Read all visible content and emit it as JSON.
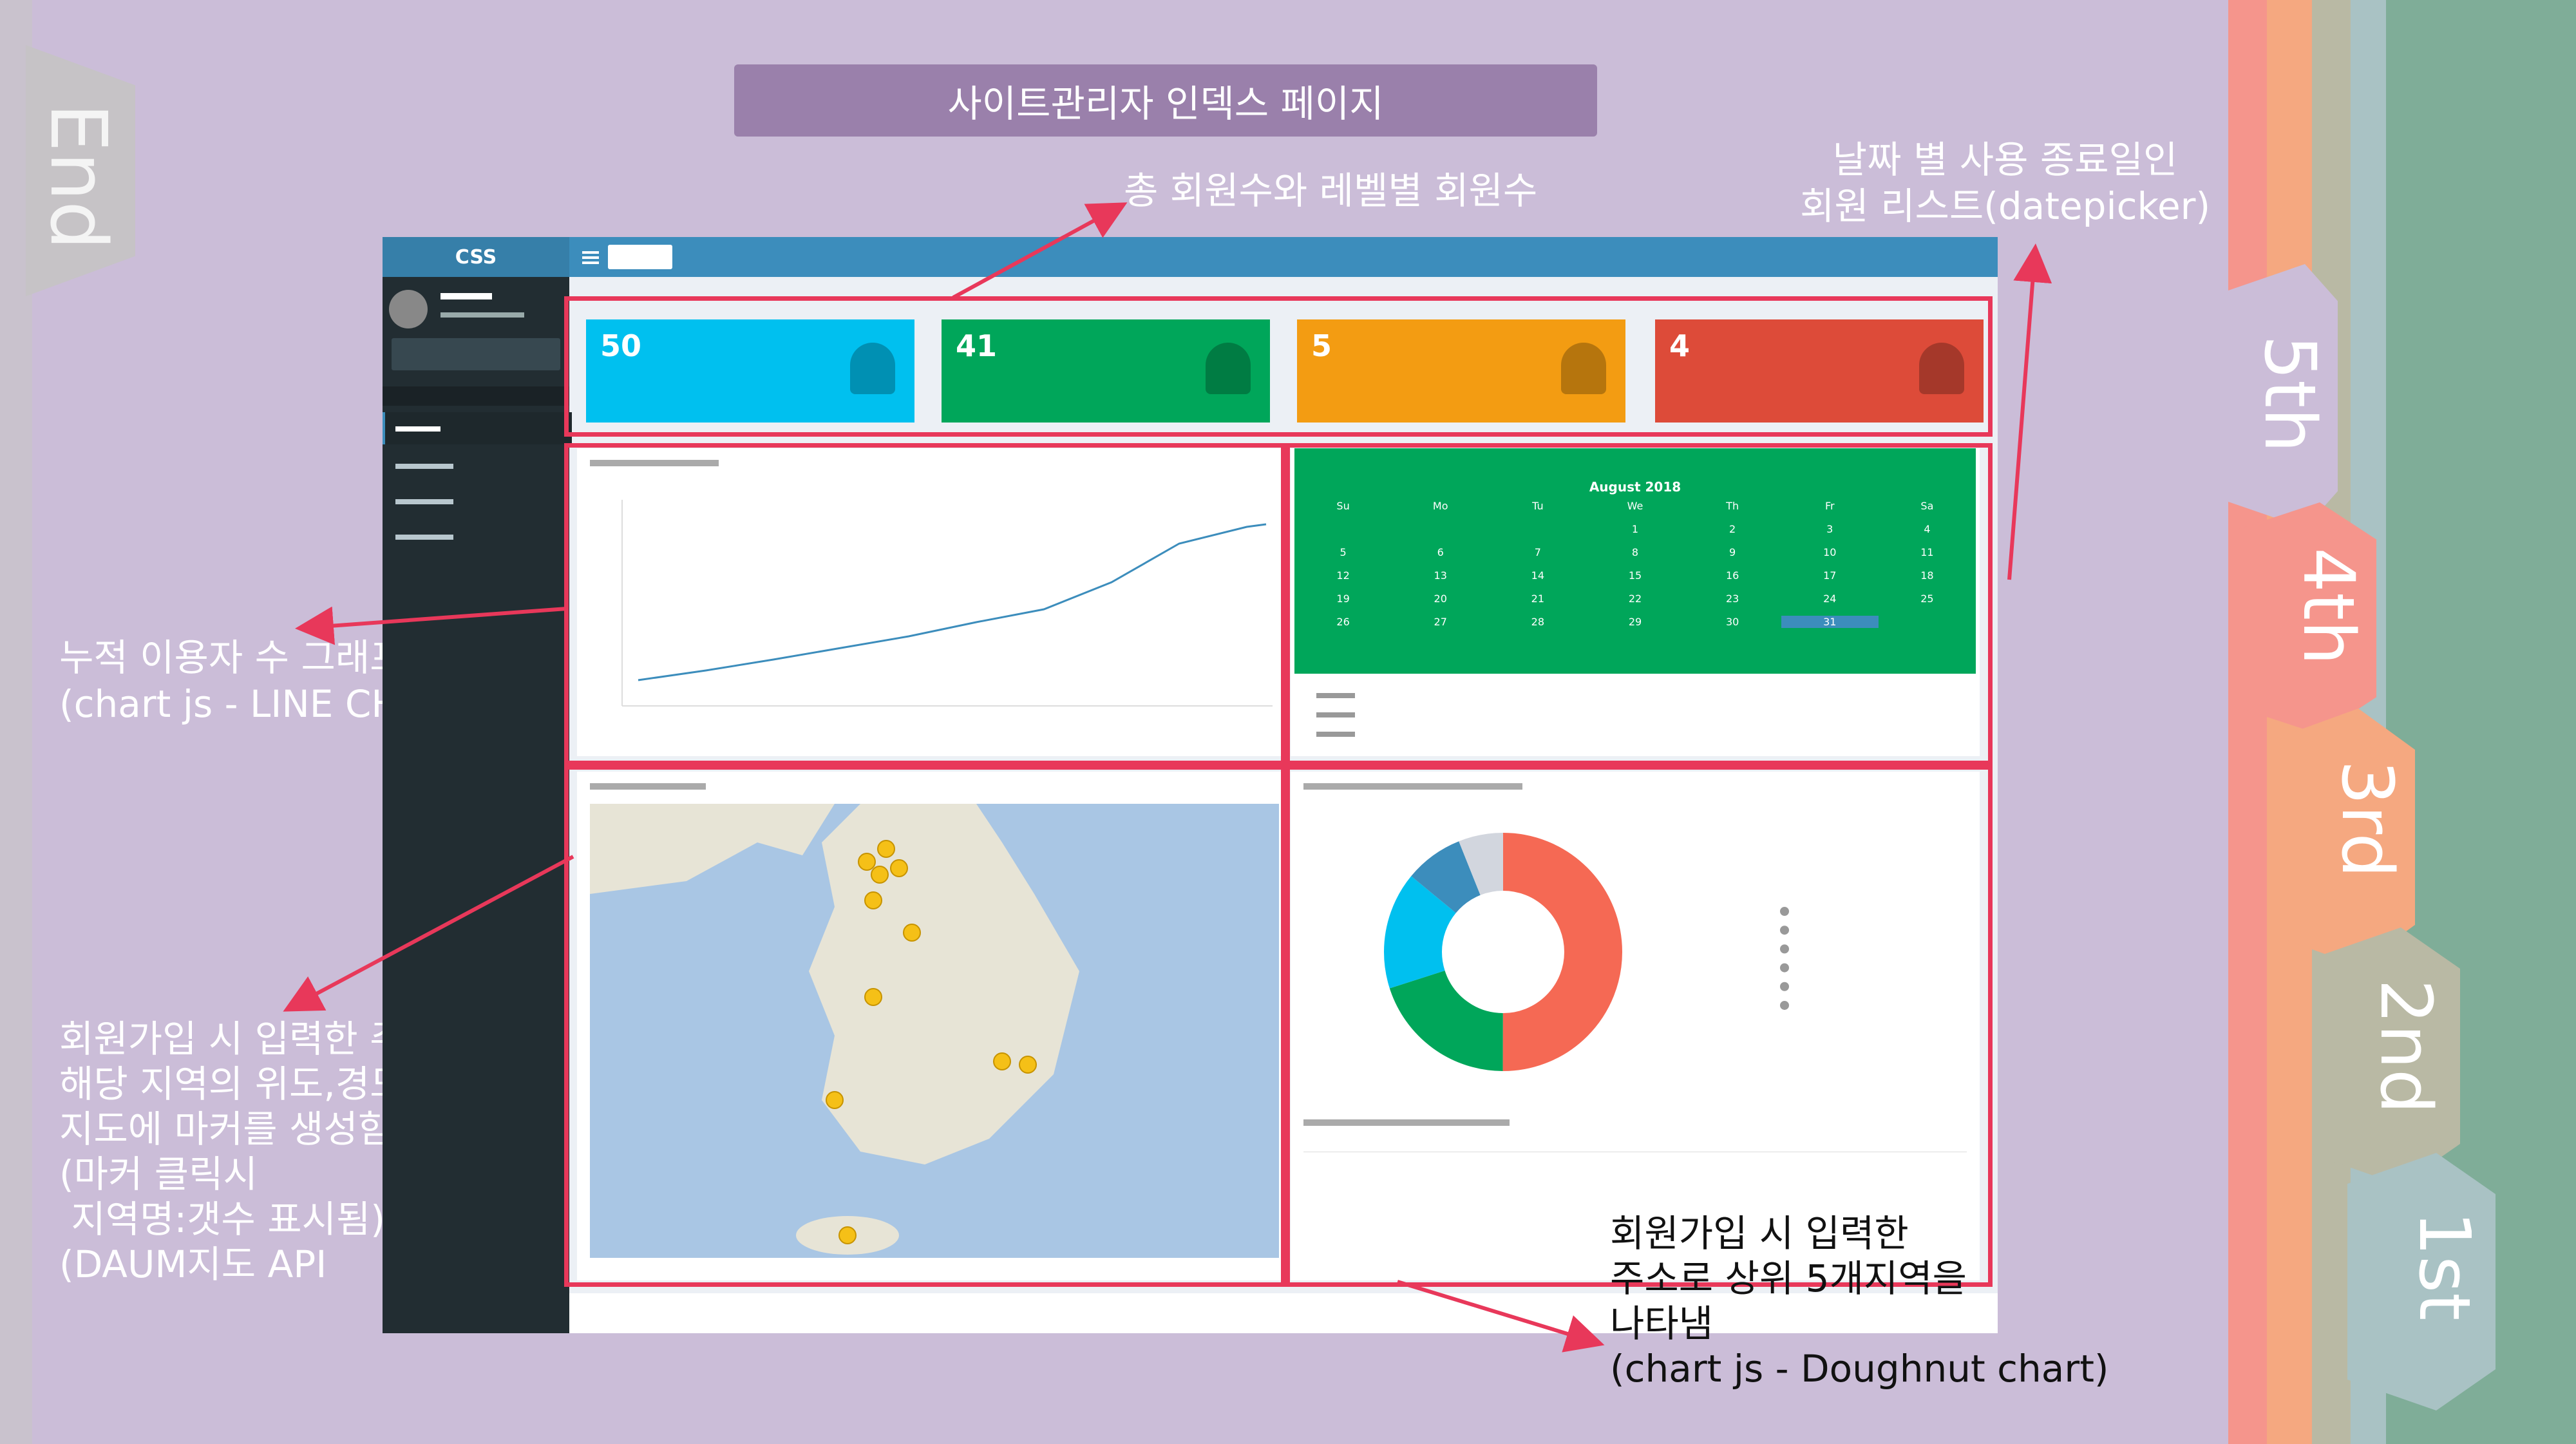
{
  "page": {
    "title": "사이트관리자 인덱스 페이지"
  },
  "tabs": [
    "End",
    "5th",
    "4th",
    "3rd",
    "2nd",
    "1st"
  ],
  "annotations": {
    "top": "총 회원수와 레벨별 회원수",
    "top_right": "날짜 별 사용 종료일인\n회원 리스트(datepicker)",
    "left_mid": "누적 이용자 수 그래프\n(chart js - LINE CHART)",
    "left_bottom": "회원가입 시 입력한 주소로\n해당 지역의 위도,경도로\n지도에 마커를 생성함\n(마커 클릭시\n 지역명:갯수 표시됨)\n(DAUM지도 API",
    "bottom_right": "회원가입 시 입력한\n주소로 상위 5개지역을\n나타냄\n(chart js - Doughnut chart)"
  },
  "dashboard": {
    "logo": "CSS",
    "stats": [
      {
        "value": "50",
        "color": "#00c0ef"
      },
      {
        "value": "41",
        "color": "#00a65a"
      },
      {
        "value": "5",
        "color": "#f39c12"
      },
      {
        "value": "4",
        "color": "#dd4b39"
      }
    ],
    "calendar": {
      "month": "August 2018",
      "days": [
        "Su",
        "Mo",
        "Tu",
        "We",
        "Th",
        "Fr",
        "Sa"
      ],
      "rows": [
        [
          "",
          "",
          "",
          "1",
          "2",
          "3",
          "4"
        ],
        [
          "5",
          "6",
          "7",
          "8",
          "9",
          "10",
          "11"
        ],
        [
          "12",
          "13",
          "14",
          "15",
          "16",
          "17",
          "18"
        ],
        [
          "19",
          "20",
          "21",
          "22",
          "23",
          "24",
          "25"
        ],
        [
          "26",
          "27",
          "28",
          "29",
          "30",
          "31",
          ""
        ]
      ]
    },
    "doughnut_colors": [
      "#f56954",
      "#00a65a",
      "#00c0ef",
      "#3c8dbc",
      "#d2d6de"
    ]
  },
  "colors": {
    "background": "#cbbdd8",
    "highlight": "#e8385a",
    "stripes": [
      "#f5958c",
      "#f5a880",
      "#b9b9a4",
      "#a9c2c4",
      "#7fad98"
    ]
  }
}
